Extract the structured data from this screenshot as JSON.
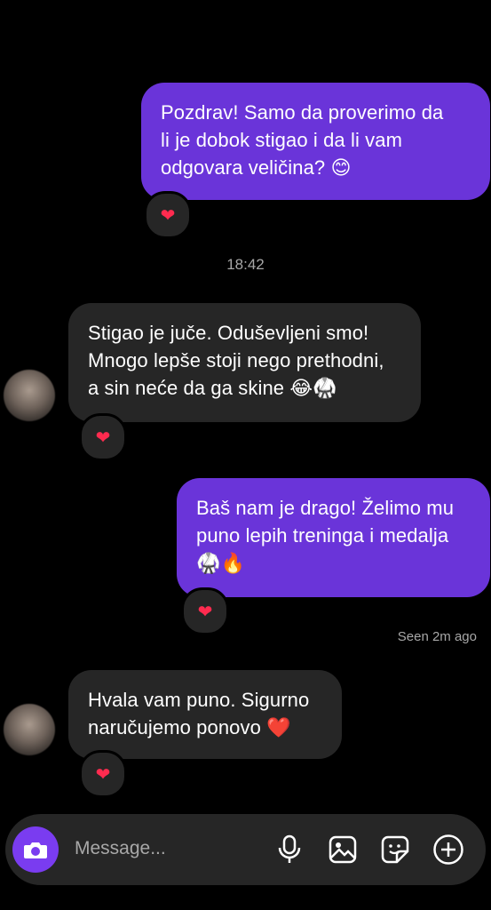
{
  "messages": [
    {
      "direction": "outgoing",
      "text": "Pozdrav! Samo da proverimo da\nli je dobok stigao i da li vam\nodgovara veličina? 😊",
      "reaction": "❤"
    },
    {
      "direction": "incoming",
      "text": "Stigao je juče. Oduševljeni smo!\nMnogo lepše stoji nego prethodni,\na sin neće da ga skine 😂🥋",
      "reaction": "❤"
    },
    {
      "direction": "outgoing",
      "text": "Baš nam je drago! Želimo mu\npuno lepih treninga i medalja\n🥋🔥",
      "reaction": "❤"
    },
    {
      "direction": "incoming",
      "text": "Hvala vam puno. Sigurno\nnaručujemo ponovo ❤️",
      "reaction": "❤"
    }
  ],
  "timestamp": "18:42",
  "seen_status": "Seen 2m ago",
  "composer": {
    "placeholder": "Message...",
    "icons": [
      "camera-icon",
      "microphone-icon",
      "gallery-icon",
      "sticker-icon",
      "plus-icon"
    ]
  },
  "colors": {
    "outgoing_bubble": "#6a34d9",
    "incoming_bubble": "#262626",
    "camera_button": "#7a3cf0",
    "reaction_heart": "#ff2b4f"
  }
}
